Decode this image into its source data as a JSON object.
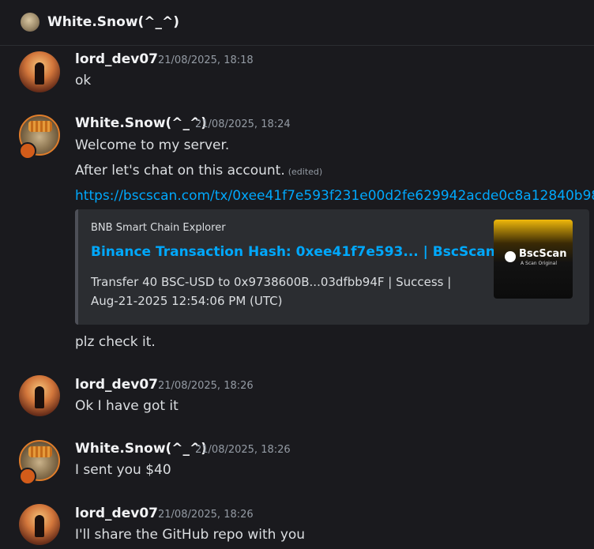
{
  "header": {
    "title": "White.Snow(^_^)"
  },
  "messages": [
    {
      "author": "lord_dev07",
      "timestamp": "21/08/2025, 18:18",
      "lines": [
        "ok"
      ]
    },
    {
      "author": "White.Snow(^_^)",
      "timestamp": "21/08/2025, 18:24",
      "lines": [
        "Welcome to my server.",
        "After let's chat on this account.",
        "https://bscscan.com/tx/0xee41f7e593f231e00d2fe629942acde0c8a12840b98",
        "plz check it."
      ],
      "edited_label": "(edited)",
      "embed": {
        "provider": "BNB Smart Chain Explorer",
        "title": "Binance Transaction Hash: 0xee41f7e593... | BscScan",
        "description_line1": "Transfer 40 BSC-USD to 0x9738600B...03dfbb94F | Success |",
        "description_line2": "Aug-21-2025 12:54:06 PM (UTC)",
        "thumbnail_name": "BscScan",
        "thumbnail_sub": "A Scan Original"
      }
    },
    {
      "author": "lord_dev07",
      "timestamp": "21/08/2025, 18:26",
      "lines": [
        "Ok I have got it"
      ]
    },
    {
      "author": "White.Snow(^_^)",
      "timestamp": "21/08/2025, 18:26",
      "lines": [
        "I sent you $40"
      ]
    },
    {
      "author": "lord_dev07",
      "timestamp": "21/08/2025, 18:26",
      "lines": [
        "I'll share the GitHub repo with you"
      ]
    }
  ],
  "colors": {
    "link": "#00a8fc",
    "background": "#1a1a1e",
    "embed_bg": "#2b2d31"
  }
}
